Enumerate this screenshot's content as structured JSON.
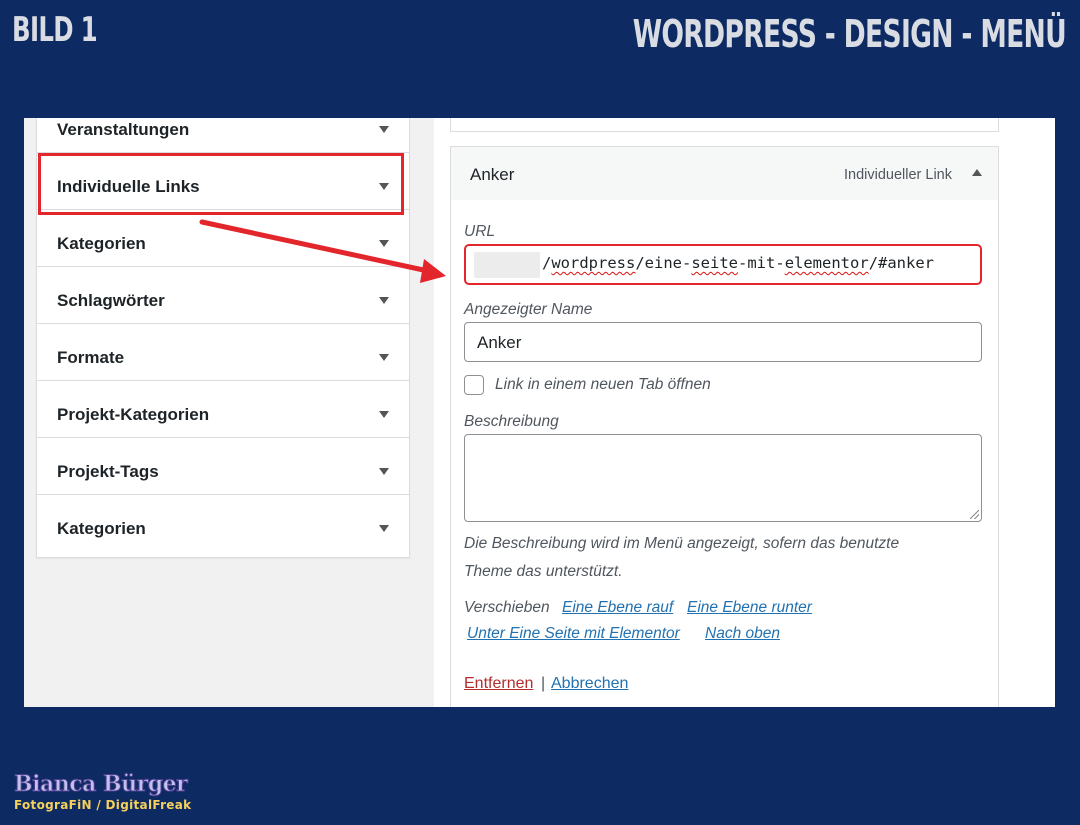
{
  "header": {
    "left_label": "BILD 1",
    "title": "WORDPRESS - DESIGN - MENÜ"
  },
  "accordion": {
    "sections": [
      {
        "label": "Veranstaltungen"
      },
      {
        "label": "Individuelle Links",
        "highlighted": true
      },
      {
        "label": "Kategorien"
      },
      {
        "label": "Schlagwörter"
      },
      {
        "label": "Formate"
      },
      {
        "label": "Projekt-Kategorien"
      },
      {
        "label": "Projekt-Tags"
      },
      {
        "label": "Kategorien"
      }
    ]
  },
  "menu_item": {
    "title": "Anker",
    "type": "Individueller Link",
    "url_label": "URL",
    "url_parts": [
      "/",
      "wordpress",
      "/eine-",
      "seite",
      "-mit-",
      "elementor",
      "/#anker"
    ],
    "name_label": "Angezeigter Name",
    "name_value": "Anker",
    "new_tab_label": "Link in einem neuen Tab öffnen",
    "description_label": "Beschreibung",
    "description_value": "",
    "help_line1": "Die Beschreibung wird im Menü angezeigt, sofern das benutzte",
    "help_line2": "Theme das unterstützt.",
    "move_label": "Verschieben",
    "move_links": [
      "Eine Ebene rauf",
      "Eine Ebene runter",
      "Unter Eine Seite mit Elementor",
      "Nach oben"
    ],
    "remove_label": "Entfernen",
    "separator": "|",
    "cancel_label": "Abbrechen"
  },
  "colors": {
    "background": "#0d2a63",
    "highlight": "#e3262b",
    "link": "#2271b1",
    "danger": "#b32d2e"
  },
  "logo": {
    "name": "Bianca Bürger",
    "subtitle": "FotograFiN / DigitalFreak"
  }
}
